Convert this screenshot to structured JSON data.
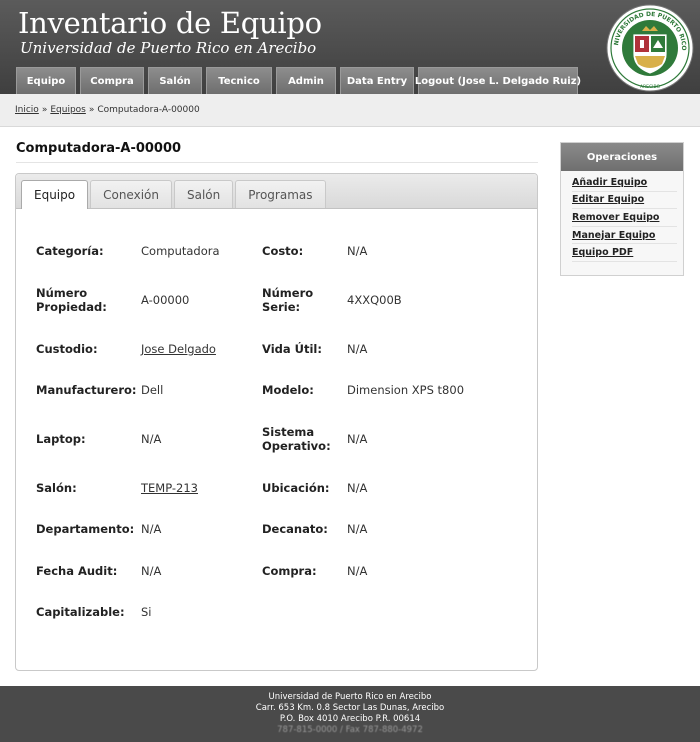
{
  "header": {
    "title": "Inventario de Equipo",
    "subtitle": "Universidad de Puerto Rico en Arecibo",
    "seal_text": "UNIVERSIDAD DE PUERTO RICO",
    "seal_city": "ARECIBO",
    "nav": [
      {
        "label": "Equipo"
      },
      {
        "label": "Compra"
      },
      {
        "label": "Salón"
      },
      {
        "label": "Tecnico"
      },
      {
        "label": "Admin"
      },
      {
        "label": "Data Entry"
      },
      {
        "label": "Logout (Jose L. Delgado Ruiz)"
      }
    ]
  },
  "breadcrumb": {
    "home": "Inicio",
    "section": "Equipos",
    "sep": "»",
    "current": "Computadora-A-00000"
  },
  "page": {
    "title": "Computadora-A-00000",
    "tabs": [
      {
        "label": "Equipo",
        "active": true
      },
      {
        "label": "Conexión",
        "active": false
      },
      {
        "label": "Salón",
        "active": false
      },
      {
        "label": "Programas",
        "active": false
      }
    ]
  },
  "fields": {
    "categoria": {
      "label": "Categoría:",
      "value": "Computadora"
    },
    "costo": {
      "label": "Costo:",
      "value": "N/A"
    },
    "numero_propiedad": {
      "label_1": "Número",
      "label_2": "Propiedad:",
      "value": "A-00000"
    },
    "numero_serie": {
      "label_1": "Número",
      "label_2": "Serie:",
      "value": "4XXQ00B"
    },
    "custodio": {
      "label": "Custodio:",
      "value": "Jose Delgado"
    },
    "vida_util": {
      "label": "Vida Útil:",
      "value": "N/A"
    },
    "manufacturero": {
      "label": "Manufacturero:",
      "value": "Dell"
    },
    "modelo": {
      "label": "Modelo:",
      "value": "Dimension XPS t800"
    },
    "laptop": {
      "label": "Laptop:",
      "value": "N/A"
    },
    "sistema_operativo": {
      "label_1": "Sistema",
      "label_2": "Operativo:",
      "value": "N/A"
    },
    "salon": {
      "label": "Salón:",
      "value": "TEMP-213"
    },
    "ubicacion": {
      "label": "Ubicación:",
      "value": "N/A"
    },
    "departamento": {
      "label": "Departamento:",
      "value": "N/A"
    },
    "decanato": {
      "label": "Decanato:",
      "value": "N/A"
    },
    "fecha_audit": {
      "label": "Fecha Audit:",
      "value": "N/A"
    },
    "compra": {
      "label": "Compra:",
      "value": "N/A"
    },
    "capitalizable": {
      "label": "Capitalizable:",
      "value": "Si"
    }
  },
  "sidebar": {
    "title": "Operaciones",
    "items": [
      {
        "label": "Añadir Equipo"
      },
      {
        "label": "Editar Equipo"
      },
      {
        "label": "Remover Equipo"
      },
      {
        "label": "Manejar Equipo"
      },
      {
        "label": "Equipo PDF"
      }
    ]
  },
  "footer": {
    "line1": "Universidad de Puerto Rico en Arecibo",
    "line2": "Carr. 653 Km. 0.8 Sector Las Dunas, Arecibo",
    "line3": "P.O. Box 4010 Arecibo P.R. 00614",
    "line4": "787-815-0000 / Fax 787-880-4972"
  },
  "colors": {
    "header_bg": "#4a4a4a",
    "nav_tab": "#7a7a7a",
    "seal_green": "#2f7a3a",
    "seal_red": "#b0323a"
  }
}
